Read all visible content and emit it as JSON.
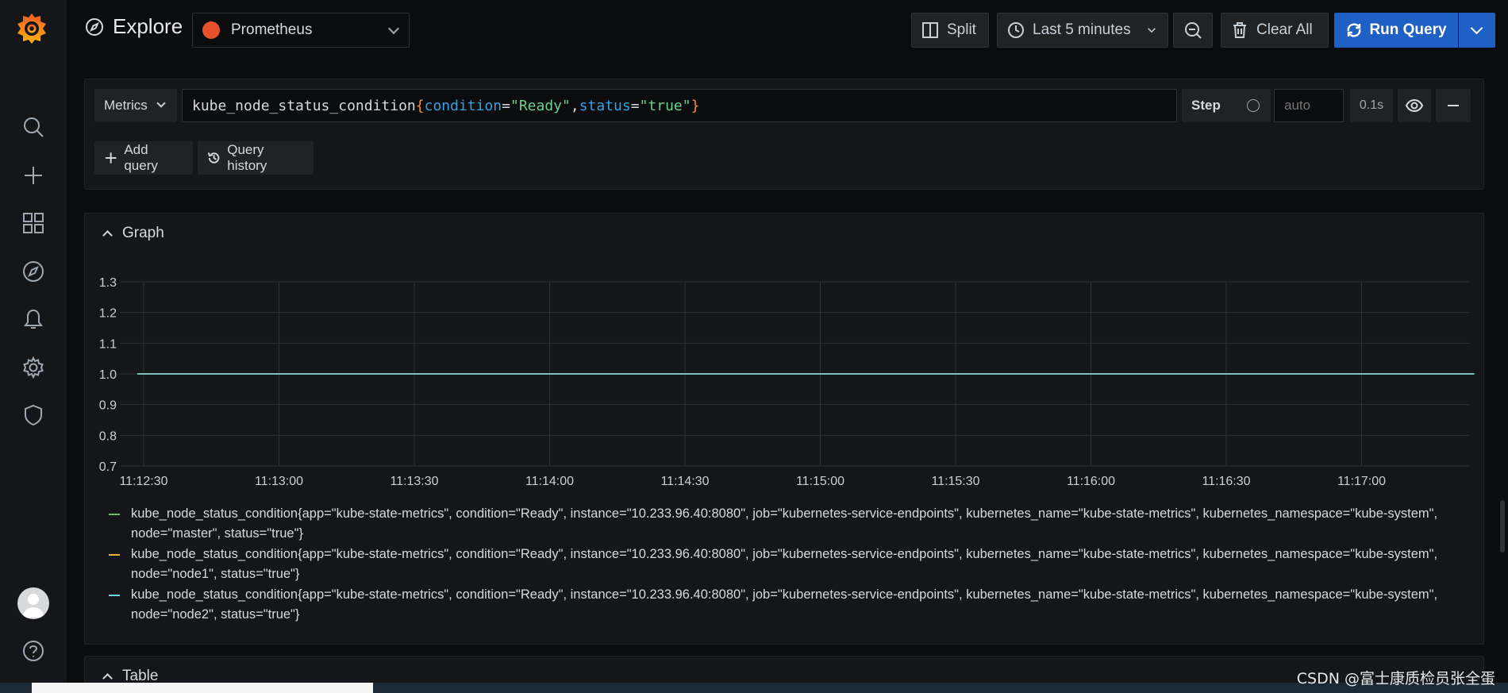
{
  "sidebar": {
    "icons": [
      "grafana-logo",
      "search-icon",
      "plus-icon",
      "dashboards-icon",
      "explore-icon",
      "alerting-icon",
      "gear-icon",
      "shield-icon",
      "avatar",
      "help-icon"
    ]
  },
  "header": {
    "title": "Explore",
    "datasource": "Prometheus",
    "split_label": "Split",
    "time_range_label": "Last 5 minutes",
    "clear_all_label": "Clear All",
    "run_query_label": "Run Query"
  },
  "query": {
    "metrics_label": "Metrics",
    "metric_name": "kube_node_status_condition",
    "open_brace": "{",
    "label1_key": "condition",
    "label1_eq": "=",
    "label1_value": "\"Ready\"",
    "sep": ",",
    "label2_key": "status",
    "label2_eq": "=",
    "label2_value": "\"true\"",
    "close_brace": "}",
    "step_label": "Step",
    "step_placeholder": "auto",
    "query_time": "0.1s",
    "add_query_label": "Add query",
    "query_history_label": "Query history"
  },
  "graph_panel": {
    "title": "Graph"
  },
  "table_panel": {
    "title": "Table"
  },
  "chart_data": {
    "type": "line",
    "x": [
      "11:12:30",
      "11:13:00",
      "11:13:30",
      "11:14:00",
      "11:14:30",
      "11:15:00",
      "11:15:30",
      "11:16:00",
      "11:16:30",
      "11:17:00"
    ],
    "x_span": [
      "11:12:30",
      "11:17:25"
    ],
    "y_ticks": [
      "1.3",
      "1.2",
      "1.1",
      "1.0",
      "0.9",
      "0.8",
      "0.7"
    ],
    "ylim": [
      0.7,
      1.3
    ],
    "grid": true,
    "legend_position": "bottom",
    "series": [
      {
        "label": "kube_node_status_condition{app=\"kube-state-metrics\", condition=\"Ready\", instance=\"10.233.96.40:8080\", job=\"kubernetes-service-endpoints\", kubernetes_name=\"kube-state-metrics\", kubernetes_namespace=\"kube-system\", node=\"master\", status=\"true\"}",
        "color": "#7eb26d",
        "values": [
          1,
          1
        ]
      },
      {
        "label": "kube_node_status_condition{app=\"kube-state-metrics\", condition=\"Ready\", instance=\"10.233.96.40:8080\", job=\"kubernetes-service-endpoints\", kubernetes_name=\"kube-state-metrics\", kubernetes_namespace=\"kube-system\", node=\"node1\", status=\"true\"}",
        "color": "#eab839",
        "values": [
          1,
          1
        ]
      },
      {
        "label": "kube_node_status_condition{app=\"kube-state-metrics\", condition=\"Ready\", instance=\"10.233.96.40:8080\", job=\"kubernetes-service-endpoints\", kubernetes_name=\"kube-state-metrics\", kubernetes_namespace=\"kube-system\", node=\"node2\", status=\"true\"}",
        "color": "#6ed0e0",
        "values": [
          1,
          1
        ]
      }
    ]
  },
  "watermark": "CSDN @富士康质检员张全蛋"
}
